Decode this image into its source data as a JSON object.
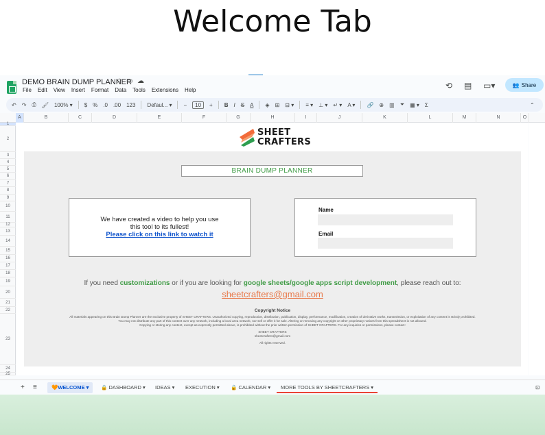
{
  "page_title": "Welcome Tab",
  "app": {
    "doc_title": "DEMO BRAIN DUMP PLANNER",
    "menu": [
      "File",
      "Edit",
      "View",
      "Insert",
      "Format",
      "Data",
      "Tools",
      "Extensions",
      "Help"
    ],
    "share_label": "Share"
  },
  "toolbar": {
    "zoom": "100%",
    "currency": "$",
    "percent": "%",
    "dec_decrease": ".0",
    "dec_increase": ".00",
    "num_format": "123",
    "font": "Defaul...",
    "font_size": "10"
  },
  "grid": {
    "columns": [
      "A",
      "B",
      "C",
      "D",
      "E",
      "F",
      "G",
      "H",
      "I",
      "J",
      "K",
      "L",
      "M",
      "N",
      "O"
    ],
    "rows": [
      "1",
      "2",
      "3",
      "4",
      "5",
      "6",
      "7",
      "8",
      "9",
      "10",
      "11",
      "12",
      "13",
      "14",
      "15",
      "16",
      "17",
      "18",
      "19",
      "20",
      "21",
      "22",
      "23",
      "24",
      "25"
    ]
  },
  "brand": {
    "line1": "SHEET",
    "line2": "CRAFTERS"
  },
  "welcome": {
    "planner_title": "BRAIN DUMP PLANNER",
    "video_line1": "We have created a video to help you use",
    "video_line2": "this tool to its fullest!",
    "video_link": "Please click on this link to watch it",
    "name_label": "Name",
    "email_label": "Email",
    "reach_prefix": "If you need ",
    "reach_customizations": "customizations",
    "reach_middle": " or if you are looking for ",
    "reach_development": "google sheets/google apps script development",
    "reach_suffix": ", please reach out to:",
    "contact_email": "sheetcrafters@gmail.com",
    "copyright_heading": "Copyright Notice",
    "copyright_p1": "All materials appearing on this Brain Dump Planner are the exclusive property of SHEET CRAFTERS. Unauthorized copying, reproduction, distribution, publication, display, performance, modification, creation of derivative works, transmission, or exploitation of any content is strictly prohibited. You may not distribute any part of this content over any network, including a local area network, nor sell or offer it for sale. Altering or removing any copyright or other proprietary notices from this spreadsheet is not allowed.",
    "copyright_p2": "Copying or storing any content, except as expressly permitted above, is prohibited without the prior written permission of SHEET CRAFTERS. For any inquiries or permissions, please contact:",
    "copyright_company": "SHEET CRAFTERS",
    "copyright_email": "sheetcrafters@gmail.com",
    "copyright_rights": "All rights reserved."
  },
  "tabs": {
    "welcome": "WELCOME",
    "dashboard": "DASHBOARD",
    "ideas": "IDEAS",
    "execution": "EXECUTION",
    "calendar": "CALENDAR",
    "more_tools": "MORE TOOLS BY SHEETCRAFTERS"
  },
  "colors": {
    "accent_green": "#3f9b45",
    "link_blue": "#1155cc",
    "email_orange": "#e8794a",
    "brand_orange": "#f26b3a",
    "brand_green": "#2e9e4f"
  }
}
